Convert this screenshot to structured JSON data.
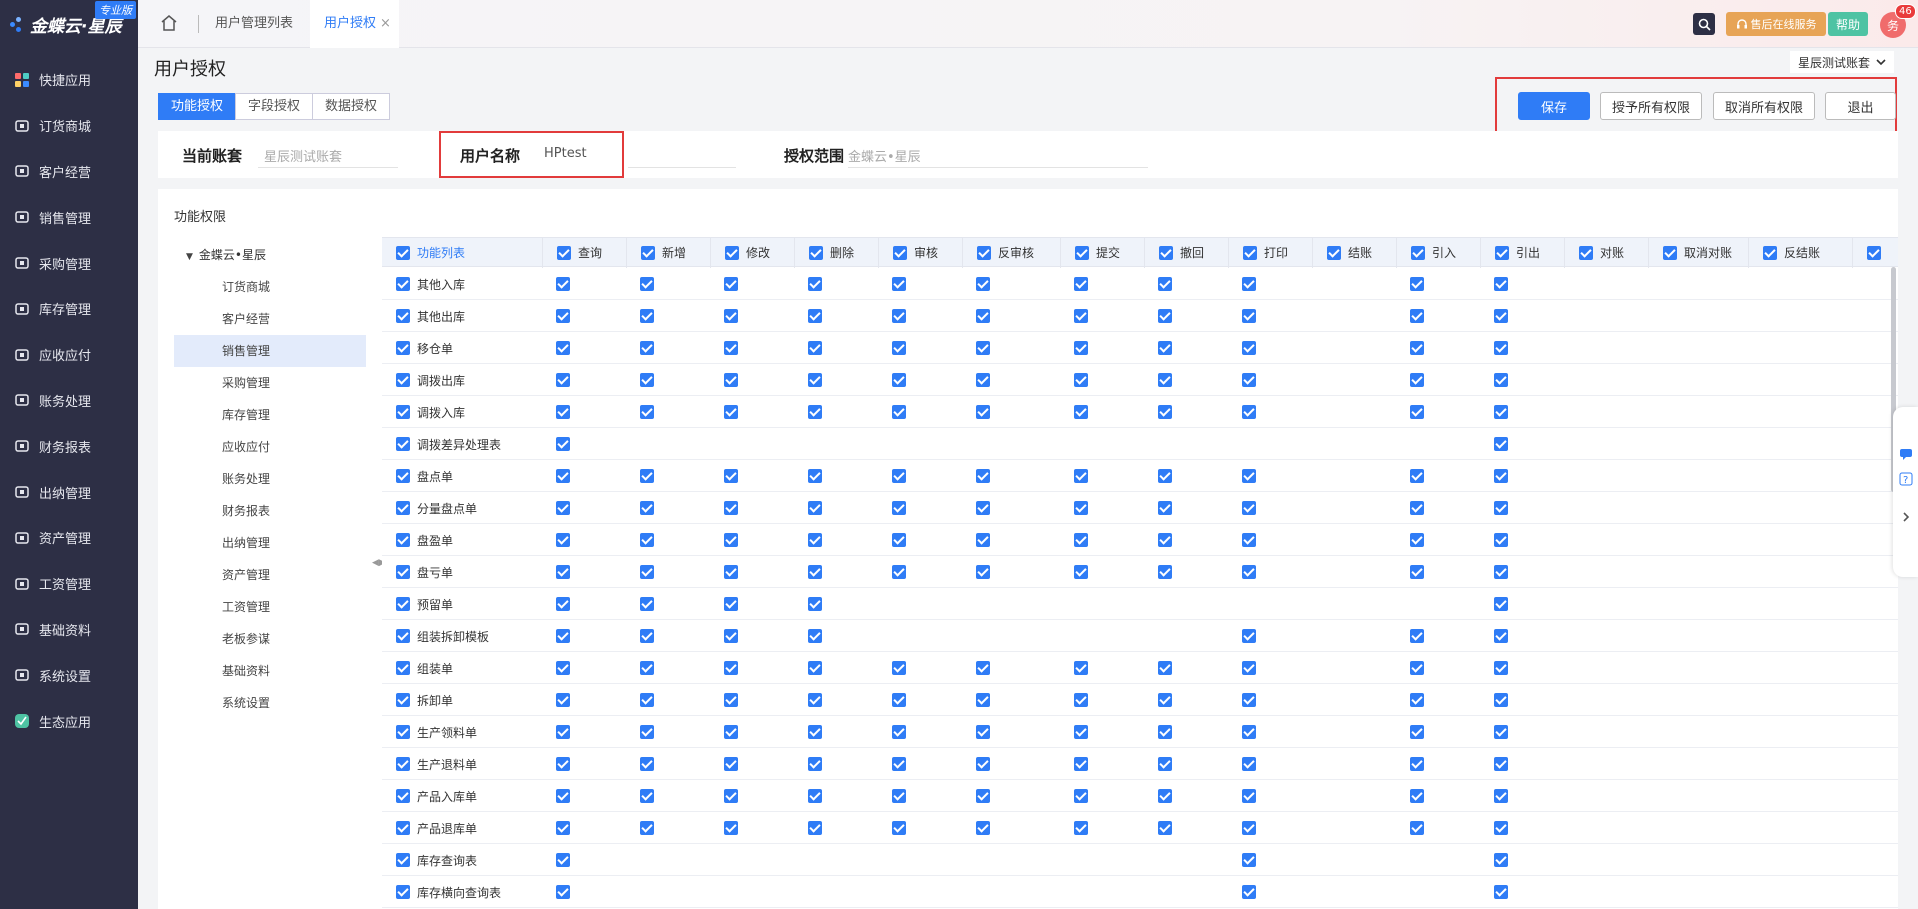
{
  "brand": {
    "name": "金蝶云·星辰",
    "edition": "专业版"
  },
  "sidebar": {
    "items": [
      {
        "label": "快捷应用",
        "icon": "grid-icon"
      },
      {
        "label": "订货商城",
        "icon": "shopping-bag-icon"
      },
      {
        "label": "客户经营",
        "icon": "customer-icon"
      },
      {
        "label": "销售管理",
        "icon": "sales-chart-icon"
      },
      {
        "label": "采购管理",
        "icon": "cart-icon"
      },
      {
        "label": "库存管理",
        "icon": "inventory-box-icon"
      },
      {
        "label": "应收应付",
        "icon": "receivable-icon"
      },
      {
        "label": "账务处理",
        "icon": "ledger-icon"
      },
      {
        "label": "财务报表",
        "icon": "report-icon"
      },
      {
        "label": "出纳管理",
        "icon": "cashier-icon"
      },
      {
        "label": "资产管理",
        "icon": "asset-icon"
      },
      {
        "label": "工资管理",
        "icon": "payroll-icon"
      },
      {
        "label": "基础资料",
        "icon": "layers-icon"
      },
      {
        "label": "系统设置",
        "icon": "settings-icon"
      },
      {
        "label": "生态应用",
        "icon": "ecosystem-icon"
      }
    ]
  },
  "topbar": {
    "tabs": [
      {
        "label": "用户管理列表",
        "active": false
      },
      {
        "label": "用户授权",
        "active": true
      }
    ],
    "close_symbol": "×",
    "service_label": "售后在线服务",
    "help_label": "帮助",
    "avatar_text": "务",
    "notification_count": "46"
  },
  "page": {
    "title": "用户授权",
    "account_selector": "星辰测试账套",
    "tabs": [
      {
        "label": "功能授权",
        "active": true
      },
      {
        "label": "字段授权",
        "active": false
      },
      {
        "label": "数据授权",
        "active": false
      }
    ],
    "actions": {
      "save": "保存",
      "grant_all": "授予所有权限",
      "revoke_all": "取消所有权限",
      "exit": "退出"
    },
    "info": {
      "account_label": "当前账套",
      "account_value": "星辰测试账套",
      "user_label": "用户名称",
      "user_value": "HPtest",
      "scope_label": "授权范围",
      "scope_value": "金蝶云•星辰"
    }
  },
  "tree": {
    "title": "功能权限",
    "root": "金蝶云•星辰",
    "expand_symbol": "▼",
    "selected": "销售管理",
    "nodes": [
      "订货商城",
      "客户经营",
      "销售管理",
      "采购管理",
      "库存管理",
      "应收应付",
      "账务处理",
      "财务报表",
      "出纳管理",
      "资产管理",
      "工资管理",
      "老板参谋",
      "基础资料",
      "系统设置"
    ]
  },
  "grid": {
    "columns": [
      "功能列表",
      "查询",
      "新增",
      "修改",
      "删除",
      "审核",
      "反审核",
      "提交",
      "撤回",
      "打印",
      "结账",
      "引入",
      "引出",
      "对账",
      "取消对账",
      "反结账"
    ],
    "rows": [
      {
        "name": "其他入库",
        "checked": [
          0,
          1,
          2,
          3,
          4,
          5,
          6,
          7,
          8,
          10,
          11
        ]
      },
      {
        "name": "其他出库",
        "checked": [
          0,
          1,
          2,
          3,
          4,
          5,
          6,
          7,
          8,
          10,
          11
        ]
      },
      {
        "name": "移仓单",
        "checked": [
          0,
          1,
          2,
          3,
          4,
          5,
          6,
          7,
          8,
          10,
          11
        ]
      },
      {
        "name": "调拨出库",
        "checked": [
          0,
          1,
          2,
          3,
          4,
          5,
          6,
          7,
          8,
          10,
          11
        ]
      },
      {
        "name": "调拨入库",
        "checked": [
          0,
          1,
          2,
          3,
          4,
          5,
          6,
          7,
          8,
          10,
          11
        ]
      },
      {
        "name": "调拨差异处理表",
        "checked": [
          0,
          11
        ]
      },
      {
        "name": "盘点单",
        "checked": [
          0,
          1,
          2,
          3,
          4,
          5,
          6,
          7,
          8,
          10,
          11
        ]
      },
      {
        "name": "分量盘点单",
        "checked": [
          0,
          1,
          2,
          3,
          4,
          5,
          6,
          7,
          8,
          10,
          11
        ]
      },
      {
        "name": "盘盈单",
        "checked": [
          0,
          1,
          2,
          3,
          4,
          5,
          6,
          7,
          8,
          10,
          11
        ]
      },
      {
        "name": "盘亏单",
        "checked": [
          0,
          1,
          2,
          3,
          4,
          5,
          6,
          7,
          8,
          10,
          11
        ]
      },
      {
        "name": "预留单",
        "checked": [
          0,
          1,
          2,
          3,
          11
        ]
      },
      {
        "name": "组装拆卸模板",
        "checked": [
          0,
          1,
          2,
          3,
          8,
          10,
          11
        ]
      },
      {
        "name": "组装单",
        "checked": [
          0,
          1,
          2,
          3,
          4,
          5,
          6,
          7,
          8,
          10,
          11
        ]
      },
      {
        "name": "拆卸单",
        "checked": [
          0,
          1,
          2,
          3,
          4,
          5,
          6,
          7,
          8,
          10,
          11
        ]
      },
      {
        "name": "生产领料单",
        "checked": [
          0,
          1,
          2,
          3,
          4,
          5,
          6,
          7,
          8,
          10,
          11
        ]
      },
      {
        "name": "生产退料单",
        "checked": [
          0,
          1,
          2,
          3,
          4,
          5,
          6,
          7,
          8,
          10,
          11
        ]
      },
      {
        "name": "产品入库单",
        "checked": [
          0,
          1,
          2,
          3,
          4,
          5,
          6,
          7,
          8,
          10,
          11
        ]
      },
      {
        "name": "产品退库单",
        "checked": [
          0,
          1,
          2,
          3,
          4,
          5,
          6,
          7,
          8,
          10,
          11
        ]
      },
      {
        "name": "库存查询表",
        "checked": [
          0,
          8,
          11
        ]
      },
      {
        "name": "库存横向查询表",
        "checked": [
          0,
          8,
          11
        ]
      }
    ]
  },
  "colors": {
    "accent": "#2f7cf6",
    "sidebar_bg": "#2d2f45",
    "highlight_border": "#e23b3b"
  }
}
